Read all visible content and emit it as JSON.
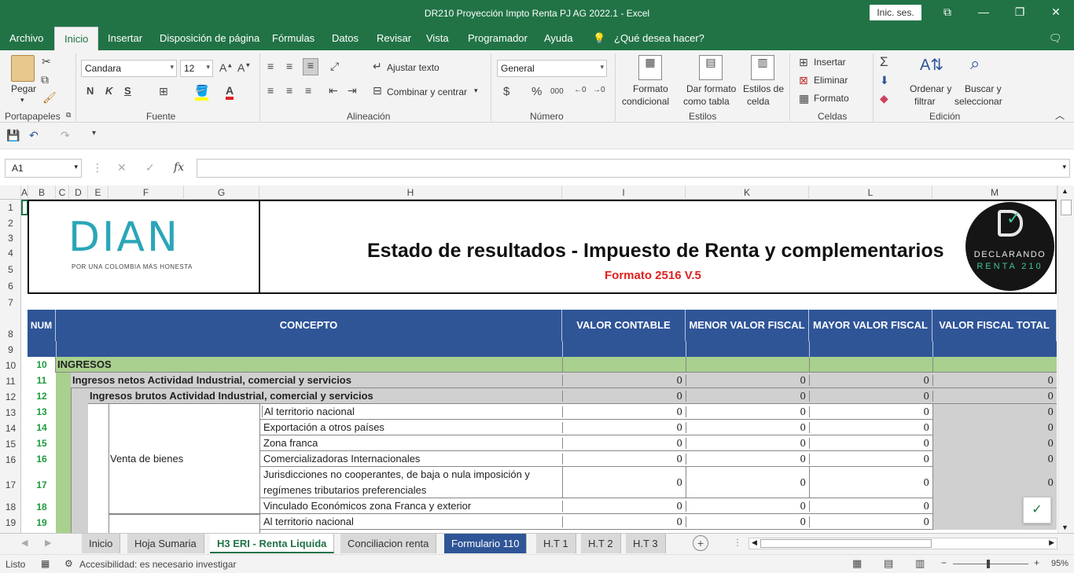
{
  "app": {
    "window_title": "DR210 Proyección Impto Renta PJ AG 2022.1  -  Excel",
    "sign_in": "Inic. ses."
  },
  "menu": [
    {
      "label": "Archivo"
    },
    {
      "label": "Inicio",
      "active": true
    },
    {
      "label": "Insertar"
    },
    {
      "label": "Disposición de página"
    },
    {
      "label": "Fórmulas"
    },
    {
      "label": "Datos"
    },
    {
      "label": "Revisar"
    },
    {
      "label": "Vista"
    },
    {
      "label": "Programador"
    },
    {
      "label": "Ayuda"
    },
    {
      "label": "¿Qué desea hacer?"
    }
  ],
  "ribbon": {
    "groups": {
      "clipboard": "Portapapeles",
      "font": "Fuente",
      "alignment": "Alineación",
      "number": "Número",
      "styles": "Estilos",
      "cells": "Celdas",
      "editing": "Edición"
    },
    "paste": "Pegar",
    "font_name": "Candara",
    "font_size": "12",
    "bold": "N",
    "italic": "K",
    "underline": "S",
    "wrap_text": "Ajustar texto",
    "merge_center": "Combinar y centrar",
    "number_format": "General",
    "currency": "$",
    "percent": "%",
    "thousands": "000",
    "cond_format_1": "Formato",
    "cond_format_2": "condicional",
    "format_table_1": "Dar formato",
    "format_table_2": "como tabla",
    "cell_styles_1": "Estilos de",
    "cell_styles_2": "celda",
    "insert": "Insertar",
    "delete": "Eliminar",
    "format": "Formato",
    "sort_1": "Ordenar y",
    "sort_2": "filtrar",
    "find_1": "Buscar y",
    "find_2": "seleccionar"
  },
  "formula_bar": {
    "name_box": "A1",
    "fx": "fx",
    "value": ""
  },
  "columns": [
    "A",
    "B",
    "C",
    "D",
    "E",
    "F",
    "G",
    "H",
    "I",
    "K",
    "L",
    "M"
  ],
  "rows": [
    "1",
    "2",
    "3",
    "4",
    "5",
    "6",
    "7",
    "8",
    "9",
    "10",
    "11",
    "12",
    "13",
    "14",
    "15",
    "16",
    "17",
    "18",
    "19"
  ],
  "sheet": {
    "logo_text": "DIAN",
    "logo_tagline": "POR UNA COLOMBIA MÁS HONESTA",
    "title": "Estado de resultados - Impuesto de Renta y complementarios",
    "subtitle": "Formato 2516 V.5",
    "badge_line1": "DECLARANDO",
    "badge_line2": "RENTA 210",
    "headers": {
      "num": "NUM",
      "concepto": "CONCEPTO",
      "valor_contable": "VALOR CONTABLE",
      "menor": "MENOR VALOR FISCAL",
      "mayor": "MAYOR VALOR FISCAL",
      "total": "VALOR FISCAL TOTAL"
    },
    "ingresos_num": "10",
    "ingresos_label": "INGRESOS",
    "venta_bienes": "Venta de bienes",
    "lines": [
      {
        "num": "11",
        "label": "Ingresos netos Actividad Industrial, comercial y servicios",
        "v1": "0",
        "v2": "0",
        "v3": "0",
        "v4": "0"
      },
      {
        "num": "12",
        "label": "Ingresos brutos Actividad Industrial, comercial y servicios",
        "v1": "0",
        "v2": "0",
        "v3": "0",
        "v4": "0"
      },
      {
        "num": "13",
        "label": "Al territorio nacional",
        "v1": "0",
        "v2": "0",
        "v3": "0",
        "v4": "0"
      },
      {
        "num": "14",
        "label": "Exportación a otros países",
        "v1": "0",
        "v2": "0",
        "v3": "0",
        "v4": "0"
      },
      {
        "num": "15",
        "label": "Zona franca",
        "v1": "0",
        "v2": "0",
        "v3": "0",
        "v4": "0"
      },
      {
        "num": "16",
        "label": "Comercializadoras Internacionales",
        "v1": "0",
        "v2": "0",
        "v3": "0",
        "v4": "0"
      },
      {
        "num": "17",
        "label": "Jurisdicciones no cooperantes, de baja o nula imposición y",
        "label2": "regímenes tributarios preferenciales",
        "v1": "0",
        "v2": "0",
        "v3": "0",
        "v4": "0"
      },
      {
        "num": "18",
        "label": "Vinculado Económicos zona Franca y exterior",
        "v1": "0",
        "v2": "0",
        "v3": "0",
        "v4": ""
      },
      {
        "num": "19",
        "label": "Al territorio nacional",
        "v1": "0",
        "v2": "0",
        "v3": "0",
        "v4": ""
      }
    ]
  },
  "tabs": [
    {
      "label": "Inicio",
      "style": "normal"
    },
    {
      "label": "Hoja Sumaria",
      "style": "normal"
    },
    {
      "label": "H3 ERI - Renta Liquida",
      "style": "active"
    },
    {
      "label": "Conciliacion renta",
      "style": "normal"
    },
    {
      "label": "Formulario 110",
      "style": "blue"
    },
    {
      "label": "H.T 1",
      "style": "normal"
    },
    {
      "label": "H.T 2",
      "style": "normal"
    },
    {
      "label": "H.T 3",
      "style": "normal"
    }
  ],
  "status": {
    "ready": "Listo",
    "accessibility": "Accesibilidad: es necesario investigar",
    "zoom": "95%"
  }
}
